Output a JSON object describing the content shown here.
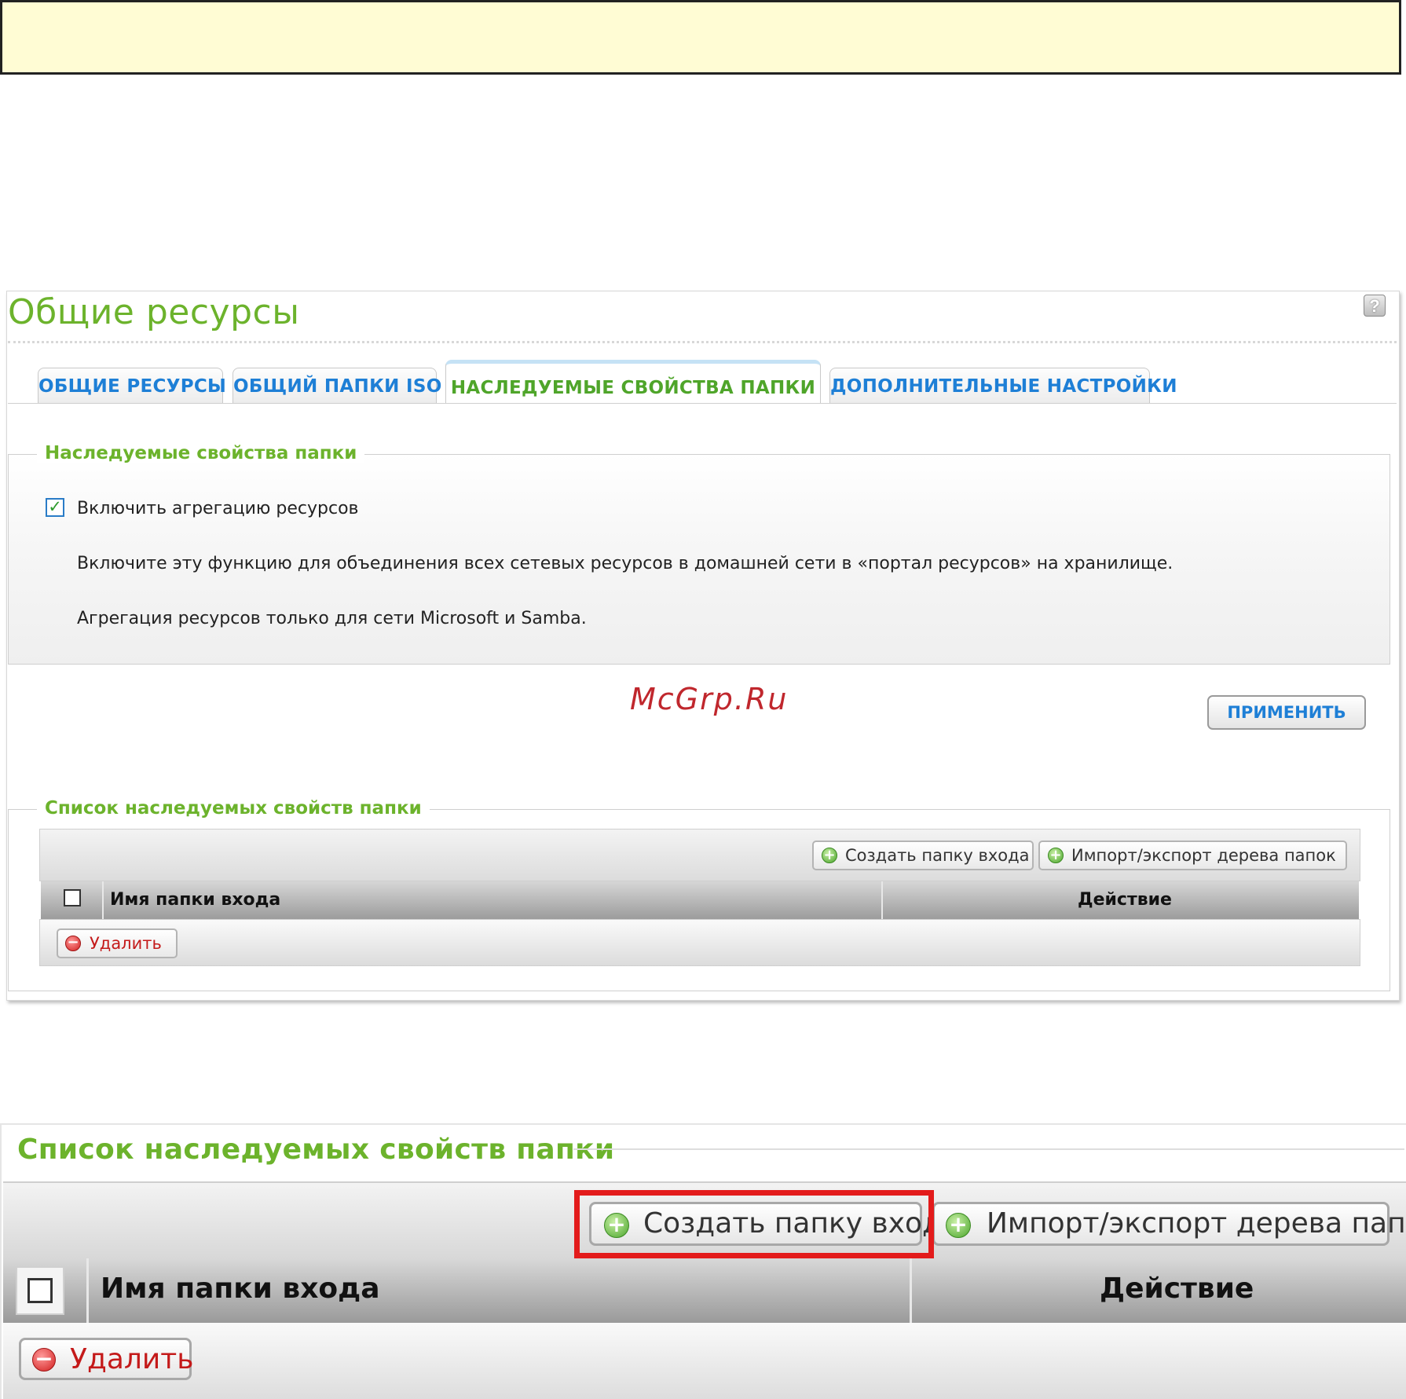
{
  "note_box": {
    "text": ""
  },
  "panel": {
    "title": "Общие ресурсы",
    "help_icon": "help-icon",
    "tabs": [
      {
        "label": "ОБЩИЕ РЕСУРСЫ",
        "active": false
      },
      {
        "label": "ОБЩИЙ ПАПКИ ISO",
        "active": false
      },
      {
        "label": "НАСЛЕДУЕМЫЕ СВОЙСТВА ПАПКИ",
        "active": true
      },
      {
        "label": "ДОПОЛНИТЕЛЬНЫЕ НАСТРОЙКИ",
        "active": false
      }
    ],
    "inherit_section": {
      "legend": "Наследуемые свойства папки",
      "checkbox_label": "Включить агрегацию ресурсов",
      "checkbox_checked": true,
      "description_1": "Включите эту функцию для объединения всех сетевых ресурсов в домашней сети в «портал ресурсов» на хранилище.",
      "description_2": "Агрегация ресурсов только для сети Microsoft и Samba."
    },
    "watermark": "McGrp.Ru",
    "apply_label": "ПРИМЕНИТЬ",
    "list_section": {
      "legend": "Список наследуемых свойств папки",
      "create_label": "Создать папку входа",
      "import_export_label": "Импорт/экспорт дерева папок",
      "columns": [
        "Имя папки входа",
        "Действие"
      ],
      "delete_label": "Удалить"
    }
  },
  "zoom": {
    "legend": "Список наследуемых свойств папки",
    "create_label": "Создать папку входа",
    "import_export_label": "Импорт/экспорт дерева папок",
    "columns": [
      "Имя папки входа",
      "Действие"
    ],
    "delete_label": "Удалить",
    "highlight_color": "#e31b1b"
  },
  "colors": {
    "accent_green": "#6cb32c",
    "link_blue": "#1e7fd6",
    "note_bg": "#fffcd4"
  }
}
